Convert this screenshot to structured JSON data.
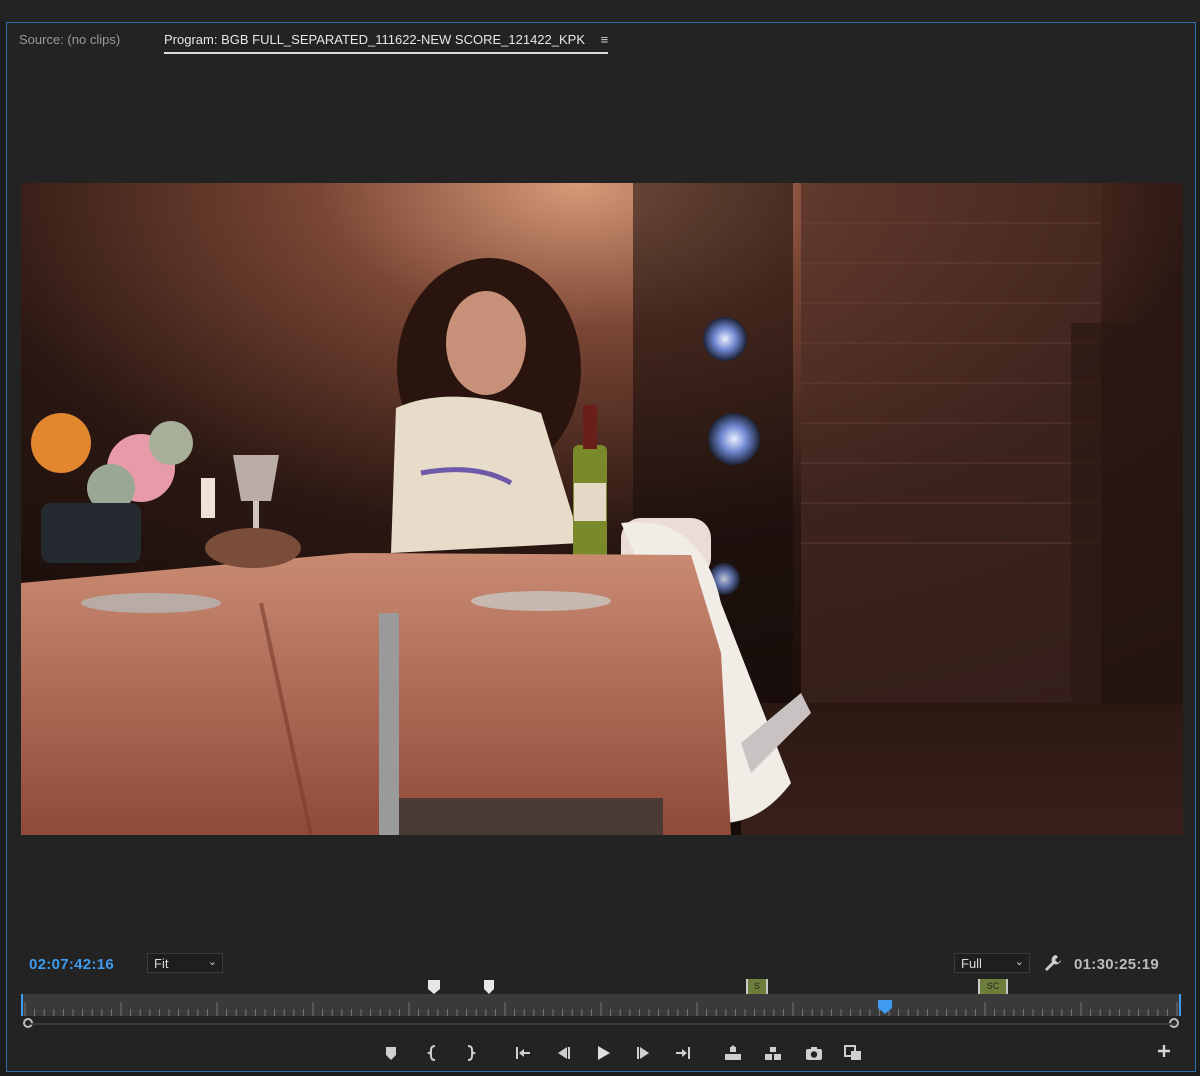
{
  "tabs": {
    "source": "Source: (no clips)",
    "program": "Program: BGB FULL_SEPARATED_111622-NEW SCORE_121422_KPK",
    "program_menu_icon": "hamburger-menu-icon"
  },
  "monitor": {
    "content": "video-frame"
  },
  "controls": {
    "playhead_timecode": "02:07:42:16",
    "zoom_value": "Fit",
    "resolution_value": "Full",
    "settings_icon": "wrench-icon",
    "duration_timecode": "01:30:25:19"
  },
  "timeline_markers": {
    "clip_marker_1_label": "S",
    "clip_marker_2_label": "SC",
    "playhead_position_fraction": 0.745
  },
  "transport": {
    "buttons": [
      "add-marker-icon",
      "mark-in-icon",
      "mark-out-icon",
      "go-to-in-icon",
      "step-back-icon",
      "play-icon",
      "step-forward-icon",
      "go-to-out-icon",
      "lift-icon",
      "extract-icon",
      "export-frame-icon",
      "comparison-view-icon"
    ],
    "add_button": "plus-icon"
  },
  "colors": {
    "accent_blue": "#3f9bef",
    "panel_bg": "#232323",
    "clip_marker_green": "#6d7f3a"
  }
}
